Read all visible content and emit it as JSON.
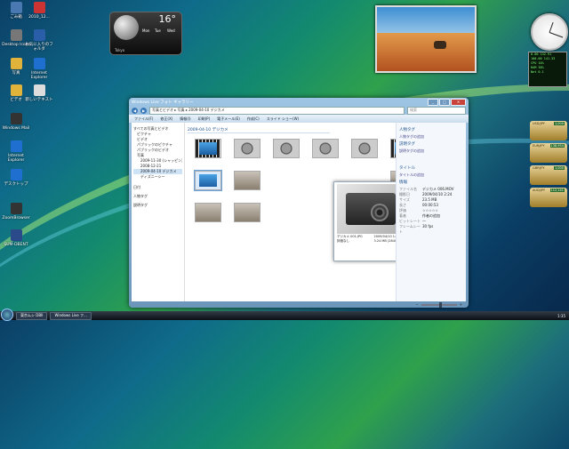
{
  "desktop_icons": [
    {
      "label": "ごみ箱",
      "color": "#4a78b0"
    },
    {
      "label": "2010_12...",
      "color": "#c33"
    },
    {
      "label": "Desktop Icons",
      "color": "#777"
    },
    {
      "label": "お気に入りのフォルダ",
      "color": "#2a5ea8"
    },
    {
      "label": "写真",
      "color": "#e2b33a"
    },
    {
      "label": "Internet Explorer",
      "color": "#1f6fd1"
    },
    {
      "label": "ビデオ",
      "color": "#e2b33a"
    },
    {
      "label": "新しいテキスト",
      "color": "#ddd"
    },
    {
      "label": "Windows Mail",
      "color": "#333"
    },
    {
      "label": "Internet Explorer",
      "color": "#1f6fd1"
    },
    {
      "label": "デスクトップ",
      "color": "#1f6fd1"
    },
    {
      "label": "ZoomBrowser",
      "color": "#333"
    },
    {
      "label": "SUM-DBENT",
      "color": "#2a4a8a"
    }
  ],
  "weather": {
    "temp": "16°",
    "location": "Tokyo",
    "rows": [
      "Mon",
      "Tue",
      "Wed"
    ]
  },
  "meter": {
    "lines": [
      "0.00 132.91",
      "100.00 141.33",
      "CPU 10%",
      "RAM 38%",
      "Net 0.1"
    ]
  },
  "stocks": [
    {
      "name": "USD/JPY",
      "value": "1,000"
    },
    {
      "name": "EUR/JPY",
      "value": "138,954"
    },
    {
      "name": "GBP/JPY",
      "value": "1,000"
    },
    {
      "name": "AUD/JPY",
      "value": "112,141"
    }
  ],
  "window": {
    "title": "Windows Live フォト ギャラリー",
    "address": "写真とビデオ ▸ 写真 ▸ 2009-04-10 デジカメ",
    "search_placeholder": "検索",
    "menu": [
      "ファイル(F)",
      "修正(X)",
      "情報(I)",
      "印刷(P)",
      "電子メール(E)",
      "作成(C)",
      "スライド ショー(W)"
    ],
    "tree": [
      "すべての写真とビデオ",
      "ピクチャ",
      "ビデオ",
      "パブリックのピクチャ",
      "パブリックのビデオ",
      "写真",
      "2009-11-30 (シャッピン)",
      "2008-12-21",
      "2009-04-10 デジカメ",
      "ディズニーシー",
      "日付",
      "人物タグ",
      "説明タグ"
    ],
    "group_header": "2009-04-10 デジカメ",
    "preview": {
      "name": "デジカメ 001.JPG",
      "date": "2009/04/10 1:33",
      "size": "3.24 MB (2840 ×",
      "rating": "評価なし"
    },
    "details": {
      "people_title": "人物タグ",
      "people_add": "人物タグの追加",
      "desc_title": "説明タグ",
      "desc_add": "説明タグの追加",
      "title_label": "タイトル",
      "title_add": "タイトルの追加",
      "info_label": "情報",
      "info": [
        [
          "ファイル名",
          "デジカメ 006.MOV"
        ],
        [
          "撮影日",
          "2009/04/10 2:24"
        ],
        [
          "サイズ",
          "23.5 MB"
        ],
        [
          "長さ",
          "00:00:53"
        ],
        [
          "評価",
          "☆☆☆☆☆"
        ],
        [
          "著者",
          "作者の追加"
        ],
        [
          "ビットレート",
          "—"
        ],
        [
          "フレームレート",
          "30 fps"
        ]
      ]
    }
  },
  "taskbar": {
    "items": [
      "東京ムシ DBII",
      "Windows Live フ..."
    ],
    "clock": "1:35"
  }
}
